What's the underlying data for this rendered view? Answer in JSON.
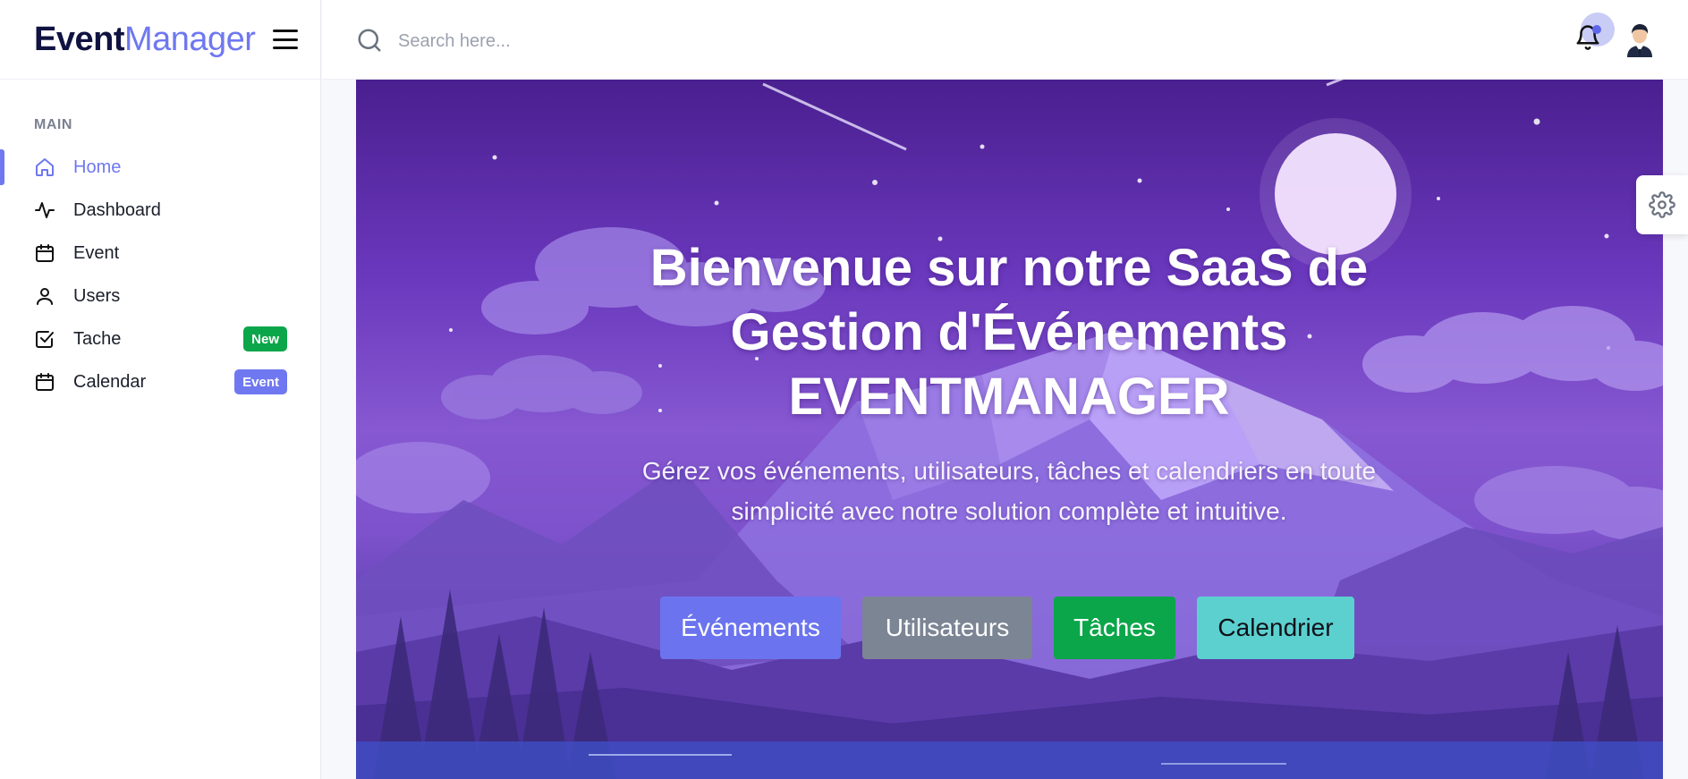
{
  "brand": {
    "bold": "Event",
    "light": "Manager"
  },
  "sidebar": {
    "section_title": "MAIN",
    "items": [
      {
        "label": "Home",
        "icon": "home-icon",
        "active": true
      },
      {
        "label": "Dashboard",
        "icon": "activity-icon"
      },
      {
        "label": "Event",
        "icon": "calendar-icon"
      },
      {
        "label": "Users",
        "icon": "user-icon"
      },
      {
        "label": "Tache",
        "icon": "checkbox-icon",
        "badge": "New",
        "badge_color": "#0ba64a"
      },
      {
        "label": "Calendar",
        "icon": "calendar-icon",
        "badge": "Event",
        "badge_color": "#6f78f0"
      }
    ]
  },
  "topbar": {
    "search_placeholder": "Search here...",
    "search_value": ""
  },
  "hero": {
    "title_line1": "Bienvenue sur notre SaaS de",
    "title_line2": "Gestion d'Événements",
    "title_line3": "EVENTMANAGER",
    "subtitle_line1": "Gérez vos événements, utilisateurs, tâches et calendriers en toute",
    "subtitle_line2": "simplicité avec notre solution complète et intuitive.",
    "buttons": {
      "events": "Événements",
      "users": "Utilisateurs",
      "tasks": "Tâches",
      "calendar": "Calendrier"
    }
  },
  "colors": {
    "accent": "#6f78f0",
    "success": "#0ba64a",
    "secondary": "#7c8594",
    "info": "#5cd0cf",
    "brand_dark": "#101341"
  }
}
